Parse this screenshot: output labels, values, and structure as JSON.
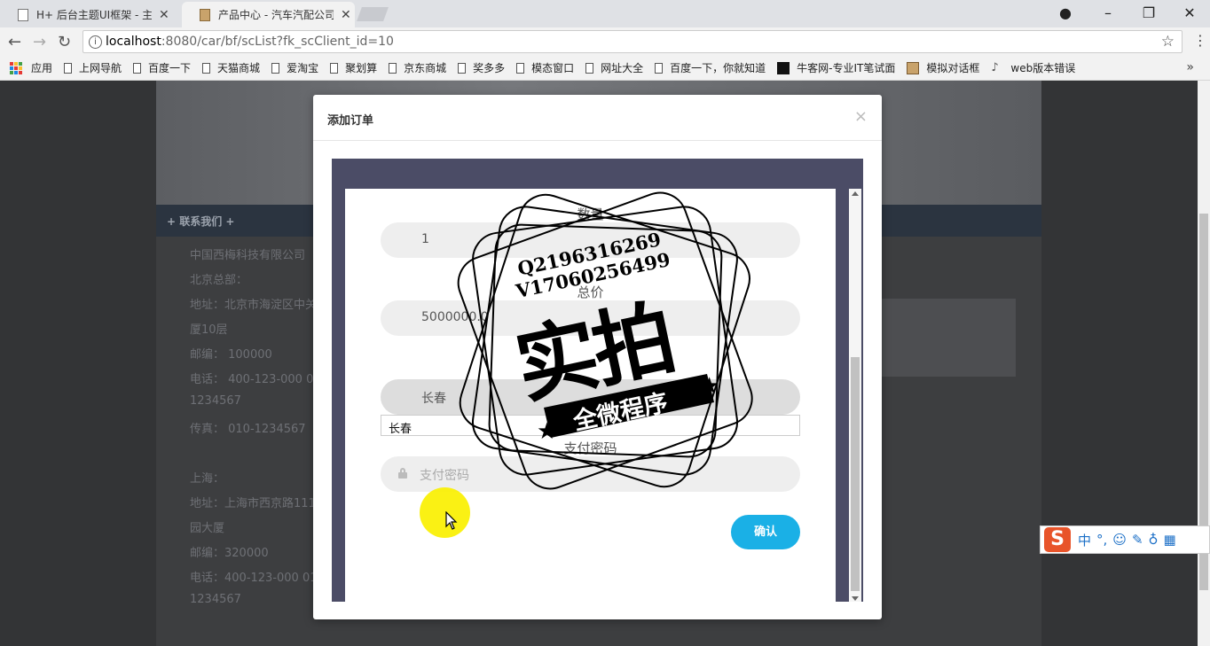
{
  "browser": {
    "tabs": [
      {
        "title": "H+ 后台主题UI框架 - 主",
        "active": false
      },
      {
        "title": "产品中心 - 汽车汽配公司",
        "active": true
      }
    ],
    "url_host": "localhost",
    "url_rest": ":8080/car/bf/scList?fk_scClient_id=10",
    "bookmarks": [
      "应用",
      "上网导航",
      "百度一下",
      "天猫商城",
      "爱淘宝",
      "聚划算",
      "京东商城",
      "奖多多",
      "模态窗口",
      "网址大全",
      "百度一下，你就知道",
      "牛客网-专业IT笔试面",
      "模拟对话框",
      "web版本错误"
    ]
  },
  "page": {
    "contact_title": "+ 联系我们 +",
    "contact_lines": [
      "中国西梅科技有限公司",
      "北京总部：",
      "地址：北京市海淀区中关",
      "厦10层",
      "邮编： 100000",
      "电话： 400-123-000 01",
      "1234567",
      "传真： 010-1234567",
      "",
      "上海：",
      "地址：上海市西京路111",
      "园大厦",
      "邮编：320000",
      "电话：400-123-000  01",
      "1234567"
    ]
  },
  "modal": {
    "title": "添加订单",
    "close": "×",
    "fields": {
      "quantity_label": "数量",
      "quantity_value": "1",
      "total_label": "总价",
      "total_value": "5000000.0",
      "city_value": "长春",
      "city_plain": "长春",
      "password_label": "支付密码",
      "password_placeholder": "支付密码"
    },
    "confirm_label": "确认"
  },
  "watermark": {
    "phone1": "Q2196316269",
    "phone2": "V17060256499",
    "main": "实拍",
    "ribbon": "全微程序"
  },
  "ime": {
    "lang": "中",
    "punct": "°,"
  },
  "colors": {
    "accent": "#1ab0e6",
    "frame": "#4b4c66",
    "highlight": "#faf000"
  }
}
